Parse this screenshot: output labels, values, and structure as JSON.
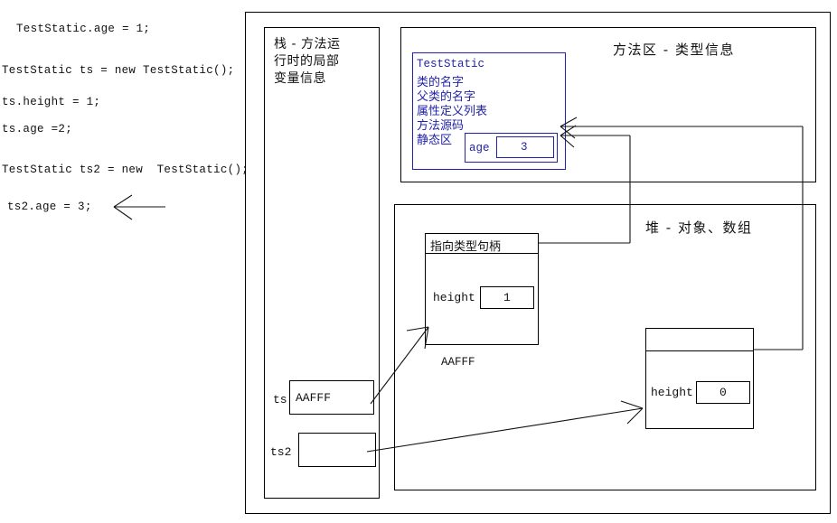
{
  "code_panel": {
    "lines": [
      "TestStatic.age = 1;",
      "TestStatic ts = new TestStatic();",
      "ts.height = 1;",
      "ts.age =2;",
      "TestStatic ts2 = new  TestStatic();",
      "ts2.age = 3;"
    ]
  },
  "diagram": {
    "stack": {
      "title": "栈 - 方法运\n行时的局部\n变量信息",
      "variables": [
        {
          "name": "ts",
          "value": "AAFFF"
        },
        {
          "name": "ts2",
          "value": ""
        }
      ]
    },
    "method_area": {
      "title": "方法区 - 类型信息",
      "class_info": {
        "lines": [
          "TestStatic",
          "类的名字",
          "父类的名字",
          "属性定义列表",
          "方法源码",
          "静态区"
        ],
        "static_field": {
          "name": "age",
          "value": "3"
        }
      }
    },
    "heap": {
      "title": "堆 - 对象、数组",
      "objects": [
        {
          "handle_label": "指向类型句柄",
          "field_name": "height",
          "field_value": "1",
          "address": "AAFFF"
        },
        {
          "handle_label": "",
          "field_name": "height",
          "field_value": "0",
          "address": ""
        }
      ]
    }
  },
  "colors": {
    "ink": "#111111",
    "blue": "#2222aa",
    "background": "#ffffff"
  }
}
